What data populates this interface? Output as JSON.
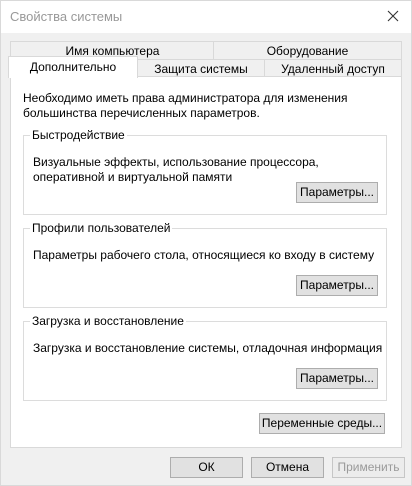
{
  "window": {
    "title": "Свойства системы"
  },
  "tabs_row1": [
    {
      "label": "Имя компьютера"
    },
    {
      "label": "Оборудование"
    }
  ],
  "tabs_row2": [
    {
      "label": "Дополнительно",
      "active": true
    },
    {
      "label": "Защита системы"
    },
    {
      "label": "Удаленный доступ"
    }
  ],
  "intro": "Необходимо иметь права администратора для изменения большинства перечисленных параметров.",
  "groups": [
    {
      "title": "Быстродействие",
      "description": "Визуальные эффекты, использование процессора, оперативной и виртуальной памяти",
      "button": "Параметры..."
    },
    {
      "title": "Профили пользователей",
      "description": "Параметры рабочего стола, относящиеся ко входу в систему",
      "button": "Параметры..."
    },
    {
      "title": "Загрузка и восстановление",
      "description": "Загрузка и восстановление системы, отладочная информация",
      "button": "Параметры..."
    }
  ],
  "env_button": "Переменные среды...",
  "footer": {
    "ok": "ОК",
    "cancel": "Отмена",
    "apply": "Применить"
  }
}
